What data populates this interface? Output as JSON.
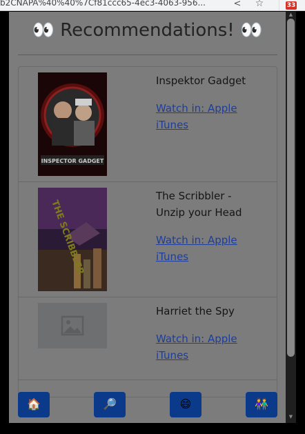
{
  "browser": {
    "url": "b2CNAPA%40%40%7Cf81ccc65-4ec3-4063-956...",
    "extension_badge": "33"
  },
  "page": {
    "title": "👀 Recommendations! 👀"
  },
  "recommendations": [
    {
      "title": "Inspektor Gadget",
      "link": "Watch in: Apple iTunes",
      "poster_text": "INSPECTOR GADGET"
    },
    {
      "title": "The Scribbler - Unzip your Head",
      "link": "Watch in: Apple iTunes",
      "poster_text": "THE SCRIBBLER"
    },
    {
      "title": "Harriet the Spy",
      "link": "Watch in: Apple iTunes"
    }
  ],
  "nav": {
    "home": "🏠",
    "search": "🔎",
    "smile": "😄",
    "people": "👫"
  },
  "colors": {
    "nav_button": "#0c3a8a",
    "link": "#1e3d99",
    "overlay_background": "#7c7c7c"
  }
}
